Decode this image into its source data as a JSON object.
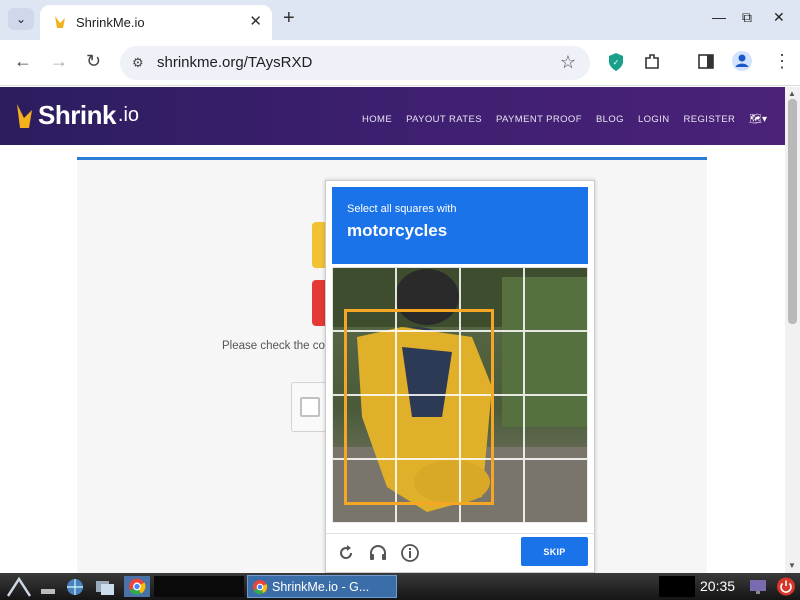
{
  "browser": {
    "tab_title": "ShrinkMe.io",
    "tab_close": "✕",
    "new_tab": "+",
    "url": "shrinkme.org/TAysRXD",
    "window_controls": [
      "—",
      "⧉",
      "✕"
    ]
  },
  "site": {
    "logo_text": "Shrink",
    "logo_suffix": ".io",
    "nav": [
      "HOME",
      "PAYOUT RATES",
      "PAYMENT PROOF",
      "BLOG",
      "LOGIN",
      "REGISTER"
    ],
    "lang_label": "▾",
    "content_text": "Please check the co"
  },
  "captcha": {
    "instruction": "Select all squares with",
    "object": "motorcycles",
    "skip_label": "SKIP",
    "grid_rows": 4,
    "grid_cols": 4
  },
  "taskbar": {
    "chrome_label": "ShrinkMe.io - G...",
    "clock": "20:35"
  },
  "colors": {
    "accent": "#1a73e8",
    "header_purple": "#3d1f70",
    "highlight_box": "#f5a623"
  }
}
